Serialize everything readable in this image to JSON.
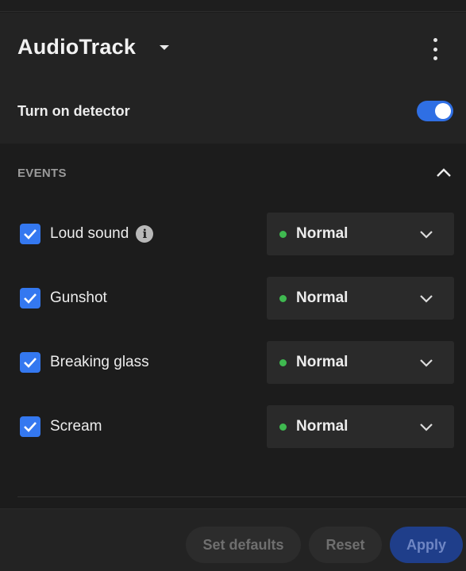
{
  "header": {
    "title": "AudioTrack",
    "detector_label": "Turn on detector",
    "detector_on": true
  },
  "events": {
    "section_title": "EVENTS",
    "items": [
      {
        "label": "Loud sound",
        "checked": true,
        "has_info": true,
        "level": "Normal"
      },
      {
        "label": "Gunshot",
        "checked": true,
        "has_info": false,
        "level": "Normal"
      },
      {
        "label": "Breaking glass",
        "checked": true,
        "has_info": false,
        "level": "Normal"
      },
      {
        "label": "Scream",
        "checked": true,
        "has_info": false,
        "level": "Normal"
      }
    ]
  },
  "footer": {
    "set_defaults_label": "Set defaults",
    "reset_label": "Reset",
    "apply_label": "Apply"
  },
  "icons": {
    "info": "i"
  },
  "colors": {
    "accent": "#3478f0",
    "toggle_on": "#2f6fe4",
    "status_normal": "#3fb950",
    "background": "#1c1c1c",
    "panel": "#232323"
  }
}
